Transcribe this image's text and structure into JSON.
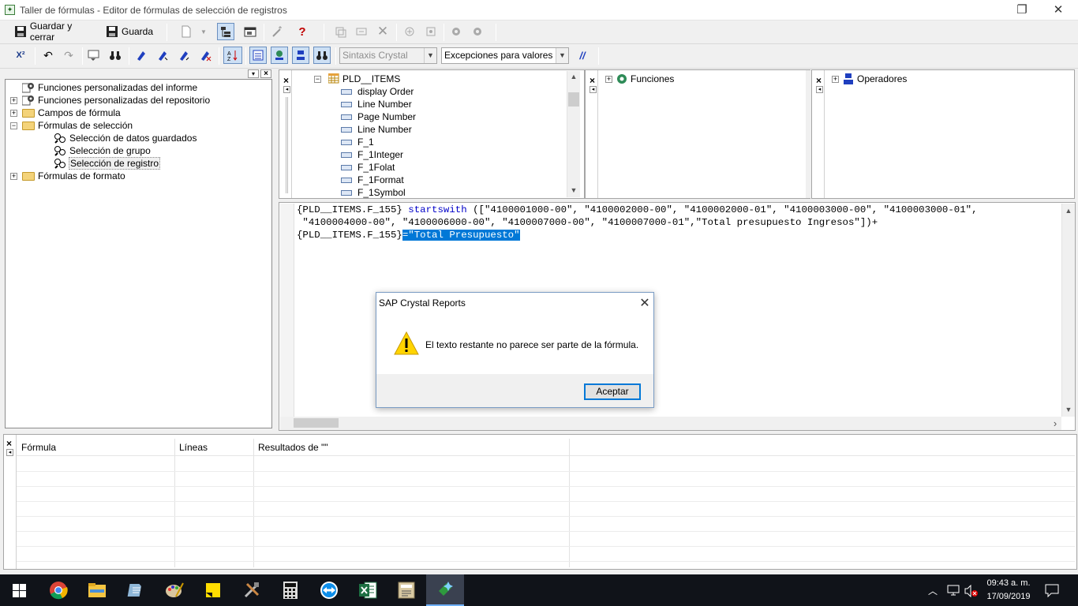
{
  "window": {
    "title": "Taller de fórmulas - Editor de fórmulas de selección de registros",
    "app_icon": "crystal-reports-icon",
    "restore_glyph": "❐",
    "close_glyph": "✕"
  },
  "toolbar1": {
    "save_close_label": "Guardar y cerrar",
    "save_label": "Guarda",
    "help_glyph": "?"
  },
  "toolbar2": {
    "syntax_value": "Sintaxis Crystal",
    "exceptions_value": "Excepciones para valores NU",
    "comment_glyph": "//",
    "x2_glyph": "X²"
  },
  "left_tree": {
    "items": [
      {
        "label": "Funciones personalizadas del informe",
        "expander": "",
        "icon": "custom-function-icon",
        "level": 0
      },
      {
        "label": "Funciones personalizadas del repositorio",
        "expander": "+",
        "icon": "repository-function-icon",
        "level": 0
      },
      {
        "label": "Campos de fórmula",
        "expander": "+",
        "icon": "folder-icon",
        "level": 0
      },
      {
        "label": "Fórmulas de selección",
        "expander": "−",
        "icon": "folder-icon",
        "level": 0
      },
      {
        "label": "Selección de datos guardados",
        "expander": "",
        "icon": "selection-formula-icon",
        "level": 1
      },
      {
        "label": "Selección de grupo",
        "expander": "",
        "icon": "selection-formula-icon",
        "level": 1
      },
      {
        "label": "Selección de registro",
        "expander": "",
        "icon": "selection-formula-icon",
        "level": 1,
        "selected": true
      },
      {
        "label": "Fórmulas de formato",
        "expander": "+",
        "icon": "folder-icon",
        "level": 0
      }
    ]
  },
  "fields_tree": {
    "table": "PLD__ITEMS",
    "expander": "−",
    "fields": [
      "display Order",
      "Line Number",
      "Page Number",
      "Line Number",
      "F_1",
      "F_1Integer",
      "F_1Folat",
      "F_1Format",
      "F_1Symbol"
    ]
  },
  "functions_tree": {
    "root": "Funciones",
    "expander": "+"
  },
  "operators_tree": {
    "root": "Operadores",
    "expander": "+"
  },
  "editor": {
    "line1_a": "{PLD__ITEMS.F_155} ",
    "line1_kw": "startswith",
    "line1_b": " ([\"4100001000-00\", \"4100002000-00\", \"4100002000-01\", \"4100003000-00\", \"4100003000-01\",",
    "line2": " \"4100004000-00\", \"4100006000-00\", \"4100007000-00\", \"4100007000-01\",\"Total presupuesto Ingresos\"])+",
    "line3_a": "{PLD__ITEMS.F_155}",
    "line3_hl": "=\"Total Presupuesto\""
  },
  "dialog": {
    "title": "SAP Crystal Reports",
    "message": "El texto restante no parece ser parte de la fórmula.",
    "ok_label": "Aceptar",
    "icon": "warning-icon",
    "close_glyph": "✕"
  },
  "results": {
    "columns": [
      "Fórmula",
      "Líneas",
      "Resultados de \"\""
    ]
  },
  "taskbar": {
    "time": "09:43 a. m.",
    "date": "17/09/2019",
    "apps": [
      "windows-start-icon",
      "chrome-icon",
      "file-explorer-icon",
      "notepad-icon",
      "paint-icon",
      "sticky-notes-icon",
      "tools-icon",
      "calculator-icon",
      "teamviewer-icon",
      "excel-icon",
      "crystal-reports-taskbar-icon",
      "crystal-formula-taskbar-icon"
    ]
  },
  "colors": {
    "accent": "#0078d7",
    "keyword": "#0000c8",
    "taskbar": "#101319"
  }
}
